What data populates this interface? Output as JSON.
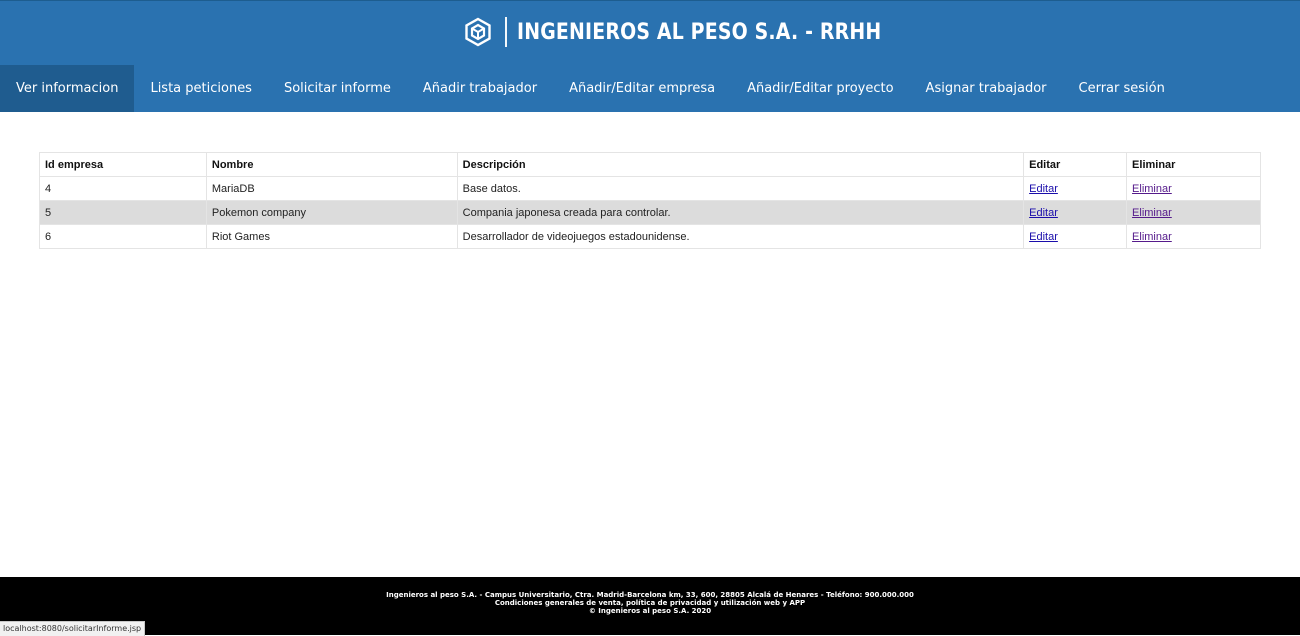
{
  "header": {
    "title": "INGENIEROS AL PESO S.A. - RRHH",
    "logo_icon": "hexagon-cube-logo"
  },
  "nav": {
    "items": [
      {
        "label": "Ver informacion",
        "active": true
      },
      {
        "label": "Lista peticiones"
      },
      {
        "label": "Solicitar informe"
      },
      {
        "label": "Añadir trabajador"
      },
      {
        "label": "Añadir/Editar empresa"
      },
      {
        "label": "Añadir/Editar proyecto"
      },
      {
        "label": "Asignar trabajador"
      },
      {
        "label": "Cerrar sesión"
      }
    ]
  },
  "table": {
    "headers": [
      "Id empresa",
      "Nombre",
      "Descripción",
      "Editar",
      "Eliminar"
    ],
    "rows": [
      {
        "id": "4",
        "nombre": "MariaDB",
        "descripcion": "Base datos.",
        "editar": "Editar",
        "eliminar": "Eliminar"
      },
      {
        "id": "5",
        "nombre": "Pokemon company",
        "descripcion": "Compania japonesa creada para controlar.",
        "editar": "Editar",
        "eliminar": "Eliminar"
      },
      {
        "id": "6",
        "nombre": "Riot Games",
        "descripcion": "Desarrollador de videojuegos estadounidense.",
        "editar": "Editar",
        "eliminar": "Eliminar"
      }
    ]
  },
  "footer": {
    "line1": "Ingenieros al peso S.A. - Campus Universitario, Ctra. Madrid-Barcelona km, 33, 600, 28805 Alcalá de Henares - Teléfono: 900.000.000",
    "line2": "Condiciones generales de venta, política de privacidad y utilización web y APP",
    "line3": "© Ingenieros al peso S.A. 2020"
  },
  "status_bar": {
    "url": "localhost:8080/solicitarInforme.jsp"
  },
  "colors": {
    "header_bg": "#2a72b0",
    "nav_active_bg": "#1f5c8f",
    "row_alt_bg": "#dcdcdc",
    "footer_bg": "#000000"
  }
}
